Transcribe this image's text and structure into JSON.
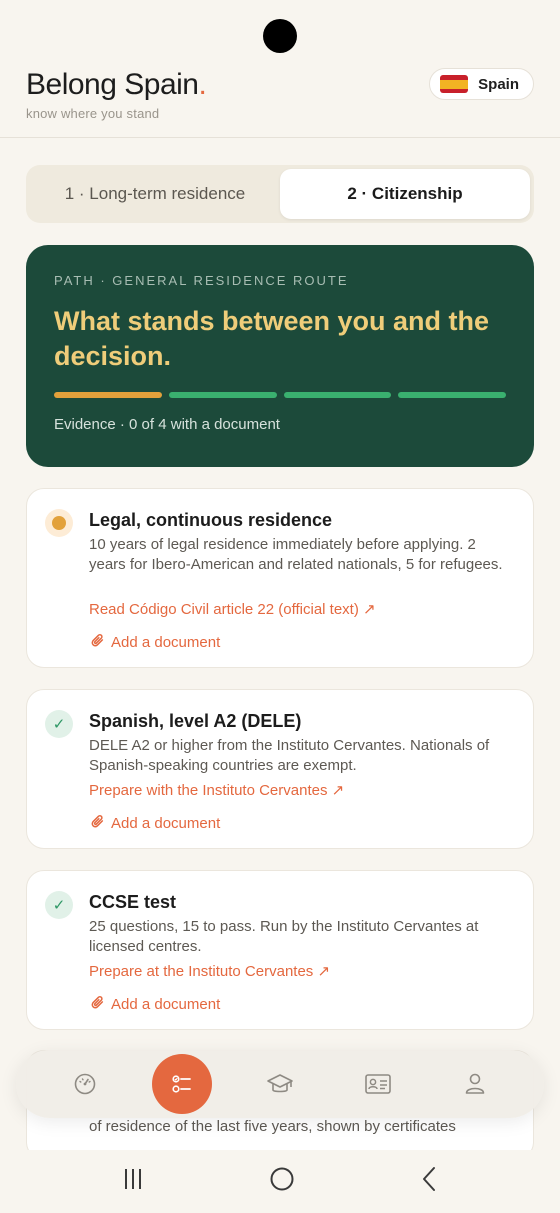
{
  "app": {
    "title": "Belong Spain",
    "title_dot": ".",
    "tagline": "know where you stand"
  },
  "country": {
    "label": "Spain"
  },
  "segments": [
    {
      "label": "1 · Long-term residence",
      "active": false
    },
    {
      "label": "2 · Citizenship",
      "active": true
    }
  ],
  "hero": {
    "eyebrow": "PATH · GENERAL RESIDENCE ROUTE",
    "title": "What stands between you and the decision.",
    "progress_colors": [
      "#e2a13b",
      "#3ab06f",
      "#3ab06f",
      "#3ab06f"
    ],
    "evidence": "Evidence · 0 of 4 with a document"
  },
  "requirements": [
    {
      "status": "pending",
      "title": "Legal, continuous residence",
      "body": "10 years of legal residence immediately before applying. 2 years for Ibero-American and related nationals, 5 for refugees.",
      "link": "Read Código Civil article 22 (official text) ↗",
      "add": "Add a document"
    },
    {
      "status": "done",
      "title": "Spanish, level A2 (DELE)",
      "body": "DELE A2 or higher from the Instituto Cervantes. Nationals of Spanish-speaking countries are exempt.",
      "link": "Prepare with the Instituto Cervantes ↗",
      "add": "Add a document"
    },
    {
      "status": "done",
      "title": "CCSE test",
      "body": "25 questions, 15 to pass. Run by the Instituto Cervantes at licensed centres.",
      "link": "Prepare at the Instituto Cervantes ↗",
      "add": "Add a document"
    }
  ],
  "partial_card": {
    "text": "of residence of the last five years, shown by certificates"
  },
  "nav": [
    "dashboard-icon",
    "checklist-icon",
    "graduation-cap-icon",
    "id-card-icon",
    "profile-icon"
  ],
  "check_glyph": "✓"
}
